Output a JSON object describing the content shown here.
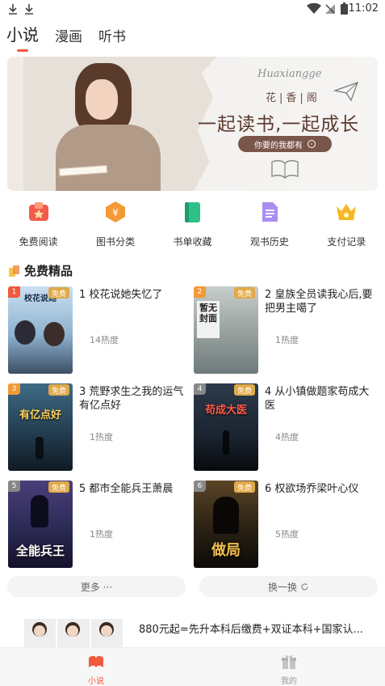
{
  "status_bar": {
    "time": "11:02"
  },
  "top_tabs": [
    {
      "label": "小说",
      "active": true
    },
    {
      "label": "漫画",
      "active": false
    },
    {
      "label": "听书",
      "active": false
    }
  ],
  "banner": {
    "script_text": "Huaxiangge",
    "brand": "花|香|阁",
    "slogan": "一起读书,一起成长",
    "pill_text": "你要的我都有"
  },
  "shortcuts": [
    {
      "label": "免费阅读",
      "icon": "free-read-icon",
      "color": "#f25b4b"
    },
    {
      "label": "图书分类",
      "icon": "category-icon",
      "color": "#f39a36"
    },
    {
      "label": "书单收藏",
      "icon": "booklist-icon",
      "color": "#2fbf88"
    },
    {
      "label": "观书历史",
      "icon": "history-icon",
      "color": "#a98ef0"
    },
    {
      "label": "支付记录",
      "icon": "payment-icon",
      "color": "#f5b825"
    }
  ],
  "section": {
    "title": "免费精品"
  },
  "books": [
    {
      "rank": "1",
      "title": "1 校花说她失忆了",
      "heat": "14热度",
      "free": "免费",
      "cover_text": "校花说她",
      "cover_bg": "#a9c7e0",
      "rank_color": "#f05a3c"
    },
    {
      "rank": "2",
      "title": "2 皇族全员读我心后,要把男主噶了",
      "heat": "1热度",
      "free": "免费",
      "cover_text": "暂无封面",
      "cover_bg": "#9aa39f",
      "rank_color": "#f39a36"
    },
    {
      "rank": "3",
      "title": "3 荒野求生之我的运气有亿点好",
      "heat": "1热度",
      "free": "免费",
      "cover_text": "有亿点好",
      "cover_bg": "#223a4c",
      "rank_color": "#f39a36"
    },
    {
      "rank": "4",
      "title": "4 从小镇做题家苟成大医",
      "heat": "4热度",
      "free": "免费",
      "cover_text": "苟成大医",
      "cover_bg": "#1b2430",
      "rank_color": "#888888"
    },
    {
      "rank": "5",
      "title": "5 都市全能兵王萧晨",
      "heat": "1热度",
      "free": "免费",
      "cover_text": "全能兵王",
      "cover_bg": "#2b2a55",
      "rank_color": "#888888"
    },
    {
      "rank": "6",
      "title": "6 权欲场乔梁叶心仪",
      "heat": "5热度",
      "free": "免费",
      "cover_text": "做局",
      "cover_bg": "#2a2114",
      "rank_color": "#888888"
    }
  ],
  "buttons": {
    "more": "更多 ···",
    "refresh": "换一换"
  },
  "ad": {
    "text": "880元起=先升本科后缴费+双证本科+国家认..."
  },
  "bottom_nav": [
    {
      "label": "小说",
      "active": true
    },
    {
      "label": "我的",
      "active": false
    }
  ]
}
